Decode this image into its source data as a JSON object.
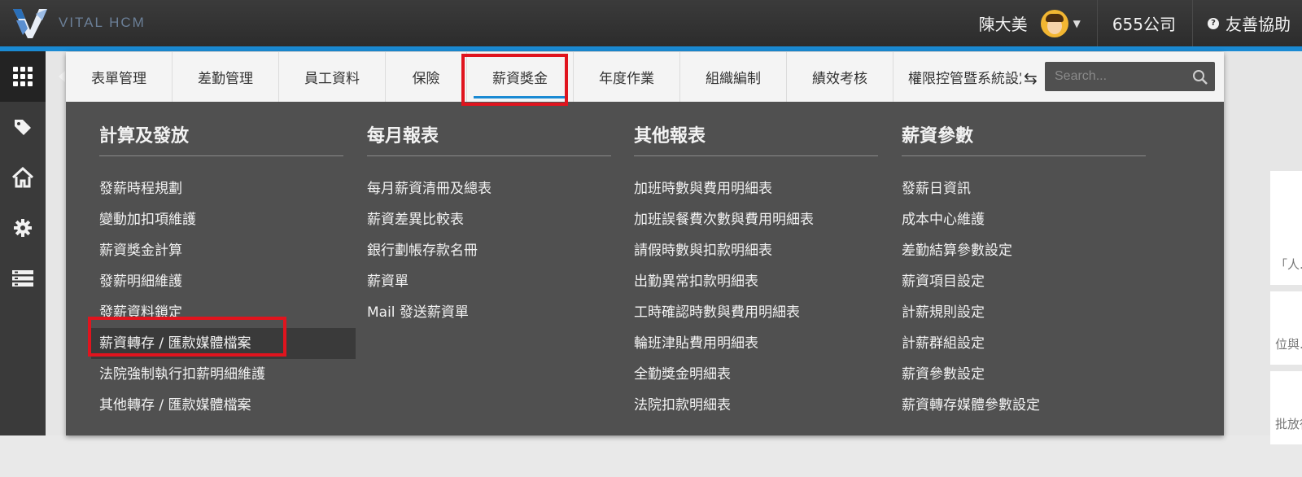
{
  "brand": {
    "name": "VITAL HCM"
  },
  "user": {
    "name": "陳大美",
    "company": "655公司",
    "help": "友善協助"
  },
  "sidebar": {
    "icons": [
      "apps-grid-icon",
      "tag-icon",
      "home-icon",
      "gear-icon",
      "list-icon"
    ]
  },
  "menu": {
    "tabs": [
      "表單管理",
      "差勤管理",
      "員工資料",
      "保險",
      "薪資獎金",
      "年度作業",
      "組織編制",
      "績效考核",
      "權限控管暨系統設定"
    ],
    "active_tab": "薪資獎金",
    "search_placeholder": "Search...",
    "columns": [
      {
        "title": "計算及發放",
        "items": [
          "發薪時程規劃",
          "變動加扣項維護",
          "薪資獎金計算",
          "發薪明細維護",
          "發薪資料鎖定",
          "薪資轉存 / 匯款媒體檔案",
          "法院強制執行扣薪明細維護",
          "其他轉存 / 匯款媒體檔案"
        ]
      },
      {
        "title": "每月報表",
        "items": [
          "每月薪資清冊及總表",
          "薪資差異比較表",
          "銀行劃帳存款名冊",
          "薪資單",
          "Mail 發送薪資單"
        ]
      },
      {
        "title": "其他報表",
        "items": [
          "加班時數與費用明細表",
          "加班誤餐費次數與費用明細表",
          "請假時數與扣款明細表",
          "出勤異常扣款明細表",
          "工時確認時數與費用明細表",
          "輪班津貼費用明細表",
          "全勤獎金明細表",
          "法院扣款明細表"
        ]
      },
      {
        "title": "薪資參數",
        "items": [
          "發薪日資訊",
          "成本中心維護",
          "差勤結算參數設定",
          "薪資項目設定",
          "計薪規則設定",
          "計薪群組設定",
          "薪資參數設定",
          "薪資轉存媒體參數設定"
        ]
      }
    ],
    "selected_item": "薪資轉存 / 匯款媒體檔案"
  },
  "background": {
    "snippets": [
      "「人...",
      "位與...",
      "批放行..."
    ]
  },
  "colors": {
    "highlight": "#e0141e",
    "accent": "#1a8ad3",
    "menu_bg": "#505050"
  }
}
